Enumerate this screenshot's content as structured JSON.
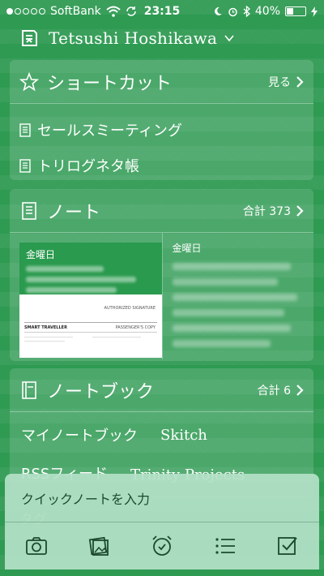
{
  "status_bar": {
    "carrier": "SoftBank",
    "time": "23:15",
    "battery_percent": "40%",
    "battery_level": 0.4,
    "signal_bars_filled": 1,
    "signal_bars_total": 5
  },
  "header": {
    "user_name": "Tetsushi Hoshikawa"
  },
  "shortcuts": {
    "title": "ショートカット",
    "more_label": "見る",
    "items": [
      {
        "label": "セールスミーティング"
      },
      {
        "label": "トリログネタ帳"
      }
    ]
  },
  "notes": {
    "title": "ノート",
    "count_label": "合計 373",
    "items": [
      {
        "day": "金曜日"
      },
      {
        "day": "金曜日"
      }
    ],
    "thumb_text": {
      "traveller": "SMART TRAVELLER",
      "passenger": "PASSENGER'S COPY",
      "signature": "AUTHORIZED SIGNATURE"
    }
  },
  "notebooks": {
    "title": "ノートブック",
    "count_label": "合計 6",
    "items": [
      {
        "label": "マイノートブック"
      },
      {
        "label": "Skitch"
      },
      {
        "label": "RSSフィード"
      },
      {
        "label": "Trinity Projects"
      }
    ]
  },
  "tags": {
    "title": "タグ"
  },
  "quick_note": {
    "placeholder": "クイックノートを入力"
  },
  "colors": {
    "background": "#2e9a52",
    "card": "rgba(255,255,255,0.14)",
    "quick_note_bg": "#b4e1c8"
  }
}
